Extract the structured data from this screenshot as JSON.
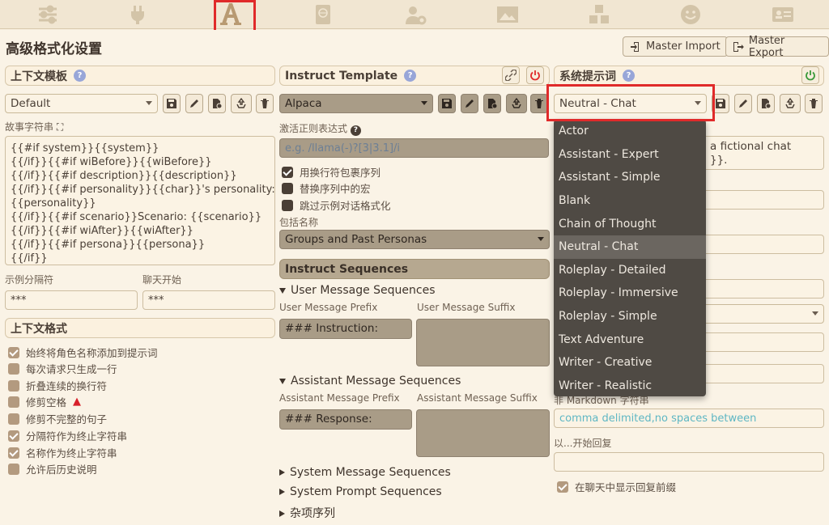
{
  "nav": {
    "icons": [
      "sliders-icon",
      "plug-icon",
      "font-a-icon",
      "book-globe-icon",
      "user-gear-icon",
      "image-icon",
      "cubes-icon",
      "smiley-icon",
      "id-card-icon"
    ],
    "active": "font-a-icon"
  },
  "page": {
    "title": "高级格式化设置",
    "master_import": "Master Import",
    "master_export": "Master Export"
  },
  "context_template": {
    "header": "上下文模板",
    "selected": "Default",
    "story_string_label": "故事字符串",
    "story_string": "{{#if system}}{{system}}\n{{/if}}{{#if wiBefore}}{{wiBefore}}\n{{/if}}{{#if description}}{{description}}\n{{/if}}{{#if personality}}{{char}}'s personality:\n{{personality}}\n{{/if}}{{#if scenario}}Scenario: {{scenario}}\n{{/if}}{{#if wiAfter}}{{wiAfter}}\n{{/if}}{{#if persona}}{{persona}}\n{{/if}}",
    "example_separator_label": "示例分隔符",
    "example_separator": "***",
    "chat_start_label": "聊天开始",
    "chat_start": "***",
    "format_header": "上下文格式",
    "options": [
      {
        "label": "始终将角色名称添加到提示词",
        "checked": true
      },
      {
        "label": "每次请求只生成一行",
        "checked": false
      },
      {
        "label": "折叠连续的换行符",
        "checked": false
      },
      {
        "label": "修剪空格",
        "checked": false
      },
      {
        "label": "修剪不完整的句子",
        "checked": false
      },
      {
        "label": "分隔符作为终止字符串",
        "checked": true
      },
      {
        "label": "名称作为终止字符串",
        "checked": true
      },
      {
        "label": "允许后历史说明",
        "checked": false
      }
    ]
  },
  "instruct_template": {
    "header": "Instruct Template",
    "selected": "Alpaca",
    "activation_regex_label": "激活正则表达式",
    "activation_regex_placeholder": "e.g. /llama(-)?[3|3.1]/i",
    "options": [
      {
        "label": "用换行符包裹序列",
        "checked": true
      },
      {
        "label": "替换序列中的宏",
        "checked": false
      },
      {
        "label": "跳过示例对话格式化",
        "checked": false
      }
    ],
    "include_names_label": "包括名称",
    "include_names": "Groups and Past Personas",
    "sequences_header": "Instruct Sequences",
    "user_seq_title": "User Message Sequences",
    "user_prefix_label": "User Message Prefix",
    "user_suffix_label": "User Message Suffix",
    "user_prefix": "### Instruction:",
    "assistant_seq_title": "Assistant Message Sequences",
    "assistant_prefix_label": "Assistant Message Prefix",
    "assistant_suffix_label": "Assistant Message Suffix",
    "assistant_prefix": "### Response:",
    "system_msg_title": "System Message Sequences",
    "system_prompt_title": "System Prompt Sequences",
    "misc_title": "杂项序列"
  },
  "system_prompt": {
    "header": "系统提示词",
    "selected": "Neutral - Chat",
    "prompt_fragment": "a fictional chat\n}}.",
    "non_markdown_label": "非 Markdown 字符串",
    "non_markdown_placeholder": "comma delimited,no spaces between",
    "start_reply_label": "以...开始回复",
    "show_prefix_label": "在聊天中显示回复前缀",
    "show_prefix_checked": true,
    "presets": [
      "Actor",
      "Assistant - Expert",
      "Assistant - Simple",
      "Blank",
      "Chain of Thought",
      "Neutral - Chat",
      "Roleplay - Detailed",
      "Roleplay - Immersive",
      "Roleplay - Simple",
      "Text Adventure",
      "Writer - Creative",
      "Writer - Realistic"
    ]
  },
  "colors": {
    "accent_red": "#e02a2a",
    "panel_bg": "#faf3e6",
    "dropdown_bg": "#4f4a44"
  }
}
